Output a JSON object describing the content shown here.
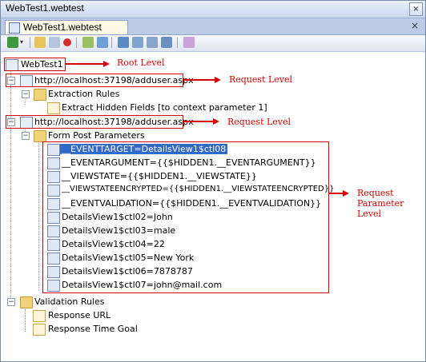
{
  "window": {
    "title": "WebTest1.webtest"
  },
  "tab": {
    "label": "WebTest1.webtest",
    "close": "×"
  },
  "window_controls": {
    "close": "×"
  },
  "tree": {
    "root": "WebTest1",
    "request1": {
      "url": "http://localhost:37198/adduser.aspx",
      "extraction_rules": "Extraction Rules",
      "extract_hidden": "Extract Hidden Fields [to context parameter 1]"
    },
    "request2": {
      "url": "http://localhost:37198/adduser.aspx",
      "form_post": "Form Post Parameters",
      "params": [
        "__EVENTTARGET=DetailsView1$ctl08",
        "__EVENTARGUMENT={{$HIDDEN1.__EVENTARGUMENT}}",
        "__VIEWSTATE={{$HIDDEN1.__VIEWSTATE}}",
        "__VIEWSTATEENCRYPTED={{$HIDDEN1.__VIEWSTATEENCRYPTED}}",
        "__EVENTVALIDATION={{$HIDDEN1.__EVENTVALIDATION}}",
        "DetailsView1$ctl02=John",
        "DetailsView1$ctl03=male",
        "DetailsView1$ctl04=22",
        "DetailsView1$ctl05=New York",
        "DetailsView1$ctl06=7878787",
        "DetailsView1$ctl07=john@mail.com"
      ]
    },
    "validation_rules": "Validation Rules",
    "response_url": "Response URL",
    "response_time_goal": "Response Time Goal"
  },
  "annotations": {
    "root_level": "Root Level",
    "request_level_1": "Request Level",
    "request_level_2": "Request Level",
    "request_param_1": "Request",
    "request_param_2": "Parameter",
    "request_param_3": "Level"
  },
  "colors": {
    "annotation": "#d60000",
    "selection": "#3169c6",
    "tab_bg": "#bccce6"
  }
}
